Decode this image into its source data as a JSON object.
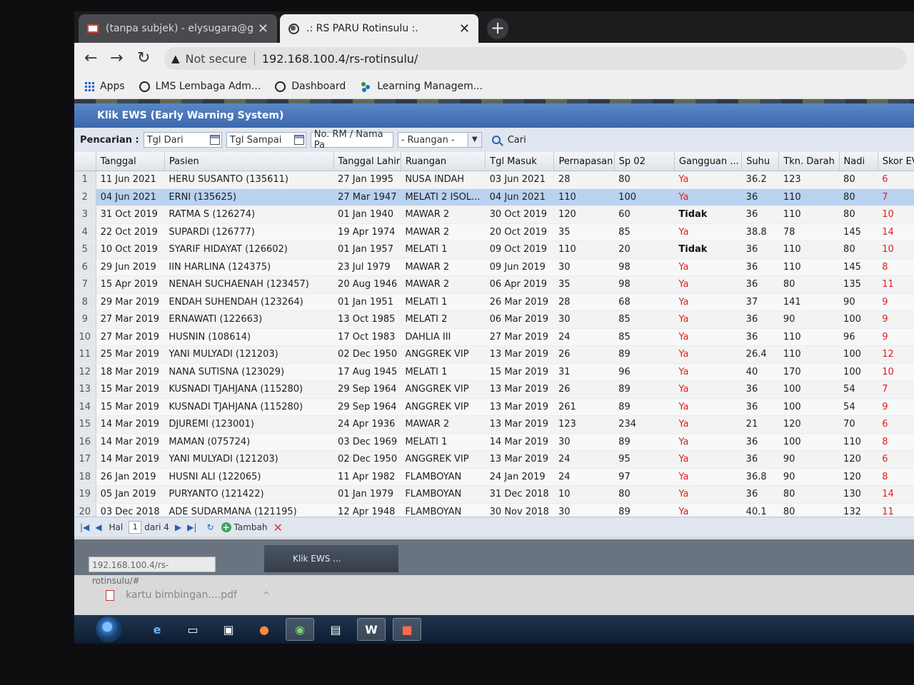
{
  "browser": {
    "tabs": [
      {
        "title": "(tanpa subjek) - elysugara@gma",
        "icon": "gmail-icon",
        "active": false
      },
      {
        "title": ".: RS PARU Rotinsulu :.",
        "icon": "globe-icon",
        "active": true
      }
    ],
    "new_tab_glyph": "+",
    "close_glyph": "✕",
    "security_label": "Not secure",
    "url": "192.168.100.4/rs-rotinsulu/",
    "bookmarks": [
      {
        "label": "Apps",
        "icon": "apps-grid-icon"
      },
      {
        "label": "LMS Lembaga Adm...",
        "icon": "globe-icon"
      },
      {
        "label": "Dashboard",
        "icon": "globe-icon"
      },
      {
        "label": "Learning Managem...",
        "icon": "lms-icon"
      }
    ]
  },
  "panel": {
    "title": "Klik EWS (Early Warning System)",
    "search": {
      "label": "Pencarian :",
      "tgl_dari_placeholder": "Tgl Dari",
      "tgl_sampai_placeholder": "Tgl Sampai",
      "rm_placeholder": "No. RM / Nama Pa",
      "ruangan_value": "- Ruangan -",
      "cari_label": "Cari"
    }
  },
  "grid": {
    "columns": [
      "Tanggal",
      "Pasien",
      "Tanggal Lahir",
      "Ruangan",
      "Tgl Masuk",
      "Pernapasan",
      "Sp 02",
      "Gangguan ...",
      "Suhu",
      "Tkn. Darah",
      "Nadi",
      "Skor EV"
    ],
    "selected_row": 2,
    "rows": [
      {
        "n": "1",
        "tanggal": "11 Jun 2021",
        "pasien": "HERU SUSANTO (135611)",
        "lahir": "27 Jan 1995",
        "ruangan": "NUSA INDAH",
        "masuk": "03 Jun 2021",
        "napas": "28",
        "sp02": "80",
        "gangguan": "Ya",
        "suhu": "36.2",
        "darah": "123",
        "nadi": "80",
        "skor": "6"
      },
      {
        "n": "2",
        "tanggal": "04 Jun 2021",
        "pasien": "ERNI (135625)",
        "lahir": "27 Mar 1947",
        "ruangan": "MELATI 2 ISOL...",
        "masuk": "04 Jun 2021",
        "napas": "110",
        "sp02": "100",
        "gangguan": "Ya",
        "suhu": "36",
        "darah": "110",
        "nadi": "80",
        "skor": "7"
      },
      {
        "n": "3",
        "tanggal": "31 Oct 2019",
        "pasien": "RATMA S (126274)",
        "lahir": "01 Jan 1940",
        "ruangan": "MAWAR 2",
        "masuk": "30 Oct 2019",
        "napas": "120",
        "sp02": "60",
        "gangguan": "Tidak",
        "suhu": "36",
        "darah": "110",
        "nadi": "80",
        "skor": "10"
      },
      {
        "n": "4",
        "tanggal": "22 Oct 2019",
        "pasien": "SUPARDI (126777)",
        "lahir": "19 Apr 1974",
        "ruangan": "MAWAR 2",
        "masuk": "20 Oct 2019",
        "napas": "35",
        "sp02": "85",
        "gangguan": "Ya",
        "suhu": "38.8",
        "darah": "78",
        "nadi": "145",
        "skor": "14"
      },
      {
        "n": "5",
        "tanggal": "10 Oct 2019",
        "pasien": "SYARIF HIDAYAT (126602)",
        "lahir": "01 Jan 1957",
        "ruangan": "MELATI 1",
        "masuk": "09 Oct 2019",
        "napas": "110",
        "sp02": "20",
        "gangguan": "Tidak",
        "suhu": "36",
        "darah": "110",
        "nadi": "80",
        "skor": "10"
      },
      {
        "n": "6",
        "tanggal": "29 Jun 2019",
        "pasien": "IIN HARLINA (124375)",
        "lahir": "23 Jul 1979",
        "ruangan": "MAWAR 2",
        "masuk": "09 Jun 2019",
        "napas": "30",
        "sp02": "98",
        "gangguan": "Ya",
        "suhu": "36",
        "darah": "110",
        "nadi": "145",
        "skor": "8"
      },
      {
        "n": "7",
        "tanggal": "15 Apr 2019",
        "pasien": "NENAH SUCHAENAH (123457)",
        "lahir": "20 Aug 1946",
        "ruangan": "MAWAR 2",
        "masuk": "06 Apr 2019",
        "napas": "35",
        "sp02": "98",
        "gangguan": "Ya",
        "suhu": "36",
        "darah": "80",
        "nadi": "135",
        "skor": "11"
      },
      {
        "n": "8",
        "tanggal": "29 Mar 2019",
        "pasien": "ENDAH SUHENDAH (123264)",
        "lahir": "01 Jan 1951",
        "ruangan": "MELATI 1",
        "masuk": "26 Mar 2019",
        "napas": "28",
        "sp02": "68",
        "gangguan": "Ya",
        "suhu": "37",
        "darah": "141",
        "nadi": "90",
        "skor": "9"
      },
      {
        "n": "9",
        "tanggal": "27 Mar 2019",
        "pasien": "ERNAWATI (122663)",
        "lahir": "13 Oct 1985",
        "ruangan": "MELATI 2",
        "masuk": "06 Mar 2019",
        "napas": "30",
        "sp02": "85",
        "gangguan": "Ya",
        "suhu": "36",
        "darah": "90",
        "nadi": "100",
        "skor": "9"
      },
      {
        "n": "10",
        "tanggal": "27 Mar 2019",
        "pasien": "HUSNIN (108614)",
        "lahir": "17 Oct 1983",
        "ruangan": "DAHLIA III",
        "masuk": "27 Mar 2019",
        "napas": "24",
        "sp02": "85",
        "gangguan": "Ya",
        "suhu": "36",
        "darah": "110",
        "nadi": "96",
        "skor": "9"
      },
      {
        "n": "11",
        "tanggal": "25 Mar 2019",
        "pasien": "YANI MULYADI (121203)",
        "lahir": "02 Dec 1950",
        "ruangan": "ANGGREK VIP",
        "masuk": "13 Mar 2019",
        "napas": "26",
        "sp02": "89",
        "gangguan": "Ya",
        "suhu": "26.4",
        "darah": "110",
        "nadi": "100",
        "skor": "12"
      },
      {
        "n": "12",
        "tanggal": "18 Mar 2019",
        "pasien": "NANA SUTISNA (123029)",
        "lahir": "17 Aug 1945",
        "ruangan": "MELATI 1",
        "masuk": "15 Mar 2019",
        "napas": "31",
        "sp02": "96",
        "gangguan": "Ya",
        "suhu": "40",
        "darah": "170",
        "nadi": "100",
        "skor": "10"
      },
      {
        "n": "13",
        "tanggal": "15 Mar 2019",
        "pasien": "KUSNADI TJAHJANA (115280)",
        "lahir": "29 Sep 1964",
        "ruangan": "ANGGREK VIP",
        "masuk": "13 Mar 2019",
        "napas": "26",
        "sp02": "89",
        "gangguan": "Ya",
        "suhu": "36",
        "darah": "100",
        "nadi": "54",
        "skor": "7"
      },
      {
        "n": "14",
        "tanggal": "15 Mar 2019",
        "pasien": "KUSNADI TJAHJANA (115280)",
        "lahir": "29 Sep 1964",
        "ruangan": "ANGGREK VIP",
        "masuk": "13 Mar 2019",
        "napas": "261",
        "sp02": "89",
        "gangguan": "Ya",
        "suhu": "36",
        "darah": "100",
        "nadi": "54",
        "skor": "9"
      },
      {
        "n": "15",
        "tanggal": "14 Mar 2019",
        "pasien": "DJUREMI (123001)",
        "lahir": "24 Apr 1936",
        "ruangan": "MAWAR 2",
        "masuk": "13 Mar 2019",
        "napas": "123",
        "sp02": "234",
        "gangguan": "Ya",
        "suhu": "21",
        "darah": "120",
        "nadi": "70",
        "skor": "6"
      },
      {
        "n": "16",
        "tanggal": "14 Mar 2019",
        "pasien": "MAMAN (075724)",
        "lahir": "03 Dec 1969",
        "ruangan": "MELATI 1",
        "masuk": "14 Mar 2019",
        "napas": "30",
        "sp02": "89",
        "gangguan": "Ya",
        "suhu": "36",
        "darah": "100",
        "nadi": "110",
        "skor": "8"
      },
      {
        "n": "17",
        "tanggal": "14 Mar 2019",
        "pasien": "YANI MULYADI (121203)",
        "lahir": "02 Dec 1950",
        "ruangan": "ANGGREK VIP",
        "masuk": "13 Mar 2019",
        "napas": "24",
        "sp02": "95",
        "gangguan": "Ya",
        "suhu": "36",
        "darah": "90",
        "nadi": "120",
        "skor": "6"
      },
      {
        "n": "18",
        "tanggal": "26 Jan 2019",
        "pasien": "HUSNI ALI (122065)",
        "lahir": "11 Apr 1982",
        "ruangan": "FLAMBOYAN",
        "masuk": "24 Jan 2019",
        "napas": "24",
        "sp02": "97",
        "gangguan": "Ya",
        "suhu": "36.8",
        "darah": "90",
        "nadi": "120",
        "skor": "8"
      },
      {
        "n": "19",
        "tanggal": "05 Jan 2019",
        "pasien": "PURYANTO (121422)",
        "lahir": "01 Jan 1979",
        "ruangan": "FLAMBOYAN",
        "masuk": "31 Dec 2018",
        "napas": "10",
        "sp02": "80",
        "gangguan": "Ya",
        "suhu": "36",
        "darah": "80",
        "nadi": "130",
        "skor": "14"
      },
      {
        "n": "20",
        "tanggal": "03 Dec 2018",
        "pasien": "ADE SUDARMANA (121195)",
        "lahir": "12 Apr 1948",
        "ruangan": "FLAMBOYAN",
        "masuk": "30 Nov 2018",
        "napas": "30",
        "sp02": "89",
        "gangguan": "Ya",
        "suhu": "40.1",
        "darah": "80",
        "nadi": "132",
        "skor": "11"
      }
    ]
  },
  "pager": {
    "hal_label": "Hal",
    "page": "1",
    "of_label": "dari 4",
    "add_label": "Tambah"
  },
  "desktop": {
    "status_url": "192.168.100.4/rs-rotinsulu/#",
    "task_label": "Klik EWS ...",
    "download_name": "kartu bimbingan....pdf"
  },
  "colors": {
    "header_blue": "#3b68ad",
    "selected_row": "#b9d2f0",
    "alert_red": "#e02020"
  }
}
